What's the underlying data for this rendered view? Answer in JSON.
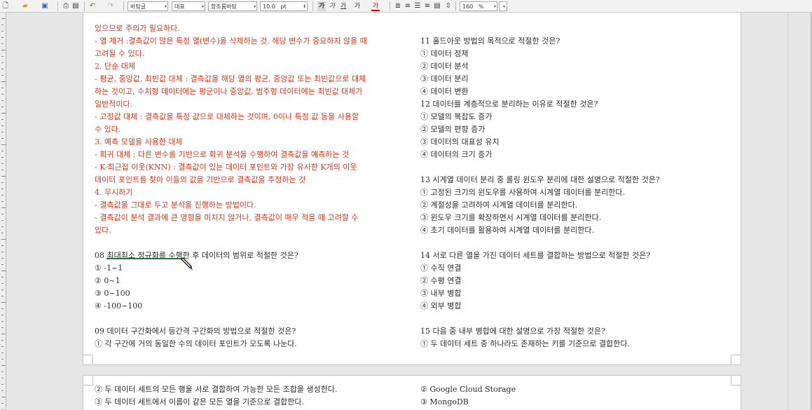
{
  "toolbar": {
    "style_select": "바탕글",
    "lang_select": "대표",
    "font_select": "함초롬바탕",
    "size_value": "10.0",
    "size_unit": "pt",
    "bold": "가",
    "italic": "가",
    "underline": "가",
    "strike": "가",
    "color_a": "가",
    "zoom_value": "160",
    "zoom_unit": "%"
  },
  "left_column": [
    {
      "text": "있으므로 주의가 필요하다.",
      "color": "red"
    },
    {
      "text": "- 열 제거 :결측값이 많은 특정 열(변수)을 삭제하는 것. 해당 변수가 중요하지 않을 때",
      "color": "red"
    },
    {
      "text": "고려될 수 있다.",
      "color": "red"
    },
    {
      "text": "2. 단순 대체",
      "color": "red"
    },
    {
      "text": "- 평균, 중앙값, 최빈값 대체 : 결측값을 해당 열의 평균, 중앙값 또는 최빈값으로 대체",
      "color": "red"
    },
    {
      "text": "하는 것이고, 수치형 데이터에는 평균이나 중앙값, 범주형 데이터에는 최빈값 대체가",
      "color": "red"
    },
    {
      "text": "일반적이다.",
      "color": "red"
    },
    {
      "text": "- 고정값 대체 : 결측값을 특정 값으로 대체하는 것이며, 0이나 특정 값 등을 사용할",
      "color": "red"
    },
    {
      "text": "수 있다.",
      "color": "red"
    },
    {
      "text": "3. 예측 모델을 사용한 대체",
      "color": "red"
    },
    {
      "text": "- 회귀 대체 : 다른 변수를 기반으로 회귀 분석을 수행하여 결측값을 예측하는 것",
      "color": "red"
    },
    {
      "text": "- K-최근접 이웃(KNN) : 결측값이 있는 데이터 포인트와 가장 유사한 K개의 이웃",
      "color": "red"
    },
    {
      "text": "데이터 포인트를 찾아 이들의 값을 기반으로 결측값을 추정하는 것",
      "color": "red"
    },
    {
      "text": "4. 무시하기",
      "color": "red"
    },
    {
      "text": "- 결측값을 그대로 두고 분석을 진행하는 방법이다.",
      "color": "red"
    },
    {
      "text": "- 결측값이 분석 결과에 큰 영향을 미치지 않거나, 결측값이 매우 적을 때 고려할 수",
      "color": "red"
    },
    {
      "text": "있다.",
      "color": "red"
    },
    {
      "text": "",
      "color": "black"
    },
    {
      "text": "08 최대최소 정규화를 수행한 후 데이터의 범위로 적절한 것은?",
      "color": "black"
    },
    {
      "text": "① -1~1",
      "color": "black"
    },
    {
      "text": "② 0~1",
      "color": "black"
    },
    {
      "text": "③ 0~100",
      "color": "black"
    },
    {
      "text": "④ -100~100",
      "color": "black"
    },
    {
      "text": "",
      "color": "black"
    },
    {
      "text": "09 데이터 구간화에서 등간격 구간화의 방법으로 적절한 것은?",
      "color": "black"
    },
    {
      "text": "① 각 구간에 거의 동일한 수의 데이터 포인트가 오도록 나눈다.",
      "color": "black"
    }
  ],
  "right_column": [
    "",
    "11 홀드아웃 방법의 목적으로 적절한 것은?",
    "① 데이터 정제",
    "② 데이터 분석",
    "③ 데이터 분리",
    "④ 데이터 변환",
    "12 데이터를 계층적으로 분리하는 이유로 적절한 것은?",
    "① 모델의 복잡도 증가",
    "② 모델의 편향 증가",
    "③ 데이터의 대표성 유지",
    "④ 데이터의 크기 증가",
    "",
    "13 시계열 데이터 분리 중 롤링 윈도우 분리에 대한 설명으로 적절한 것은?",
    "① 고정된 크기의 윈도우를 사용하여 시계열 데이터를 분리한다.",
    "② 계절성을 고려하여 시계열 데이터를 분리한다.",
    "③ 윈도우 크기를 확장하면서 시계열 데이터를 분리한다.",
    "④ 초기 데이터를 활용하여 시계열 데이터를 분리한다.",
    "",
    "14 서로 다른 열을 가진 데이터 세트를 결합하는 방법으로 적절한 것은?",
    "① 수직 연결",
    "② 수평 연결",
    "③ 내부 병합",
    "④ 외부 병합",
    "",
    "15 다음 중 내부 병합에 대한 설명으로 가장 적절한 것은?",
    "① 두 데이터 세트 중 하나라도 존재하는 키를 기준으로 결합한다."
  ],
  "page2": {
    "left": [
      "② 두 데이터 세트의 모든 행을 서로 결합하여 가능한 모든 조합을 생성한다.",
      "③ 두 데이터 세트에서 이름이 같은 모든 열을 기준으로 결합한다."
    ],
    "right": [
      "② Google Cloud Storage",
      "③ MongoDB"
    ]
  },
  "colors": {
    "red_text": "#d8341f",
    "black_text": "#2b2b2b",
    "underline": "#2f6f3a"
  }
}
